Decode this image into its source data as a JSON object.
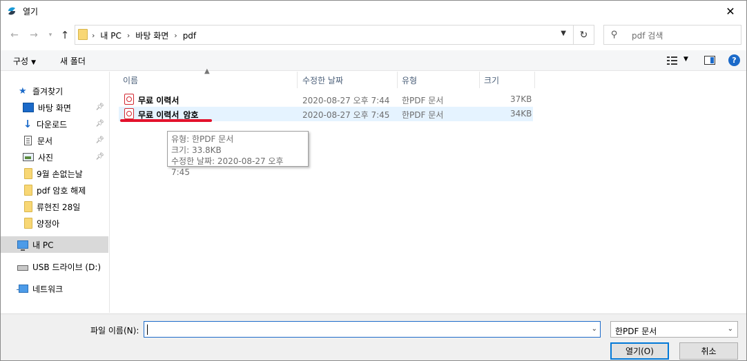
{
  "window": {
    "title": "열기"
  },
  "address": {
    "crumbs": [
      "내 PC",
      "바탕 화면",
      "pdf"
    ]
  },
  "search": {
    "placeholder": "pdf 검색"
  },
  "toolbar": {
    "organize_label": "구성",
    "new_folder_label": "새 폴더"
  },
  "sidebar": {
    "quick_access": "즐겨찾기",
    "items": [
      {
        "label": "바탕 화면",
        "icon": "desktop-icon",
        "pinned": true
      },
      {
        "label": "다운로드",
        "icon": "download-icon",
        "pinned": true
      },
      {
        "label": "문서",
        "icon": "documents-icon",
        "pinned": true
      },
      {
        "label": "사진",
        "icon": "pictures-icon",
        "pinned": true
      },
      {
        "label": "9월 손없는날",
        "icon": "folder-icon",
        "pinned": false
      },
      {
        "label": "pdf 암호 해제",
        "icon": "folder-icon",
        "pinned": false
      },
      {
        "label": "류현진 28일",
        "icon": "folder-icon",
        "pinned": false
      },
      {
        "label": "양정아",
        "icon": "folder-icon",
        "pinned": false
      }
    ],
    "this_pc": "내 PC",
    "usb": "USB 드라이브 (D:)",
    "network": "네트워크"
  },
  "columns": {
    "name": "이름",
    "modified": "수정한 날짜",
    "type": "유형",
    "size": "크기"
  },
  "files": [
    {
      "name": "무료 이력서",
      "modified": "2020-08-27 오후 7:44",
      "type": "한PDF 문서",
      "size": "37KB"
    },
    {
      "name": "무료 이력서_암호",
      "modified": "2020-08-27 오후 7:45",
      "type": "한PDF 문서",
      "size": "34KB"
    }
  ],
  "tooltip": {
    "type_line": "유형: 한PDF 문서",
    "size_line": "크기: 33.8KB",
    "date_line": "수정한 날짜: 2020-08-27 오후 7:45"
  },
  "bottom": {
    "filename_label": "파일 이름(N):",
    "filename_value": "",
    "filetype": "한PDF 문서",
    "open_label": "열기(O)",
    "cancel_label": "취소"
  },
  "colors": {
    "accent": "#0078d7",
    "highlight": "#e5f3ff",
    "annotation": "#e3122c"
  }
}
